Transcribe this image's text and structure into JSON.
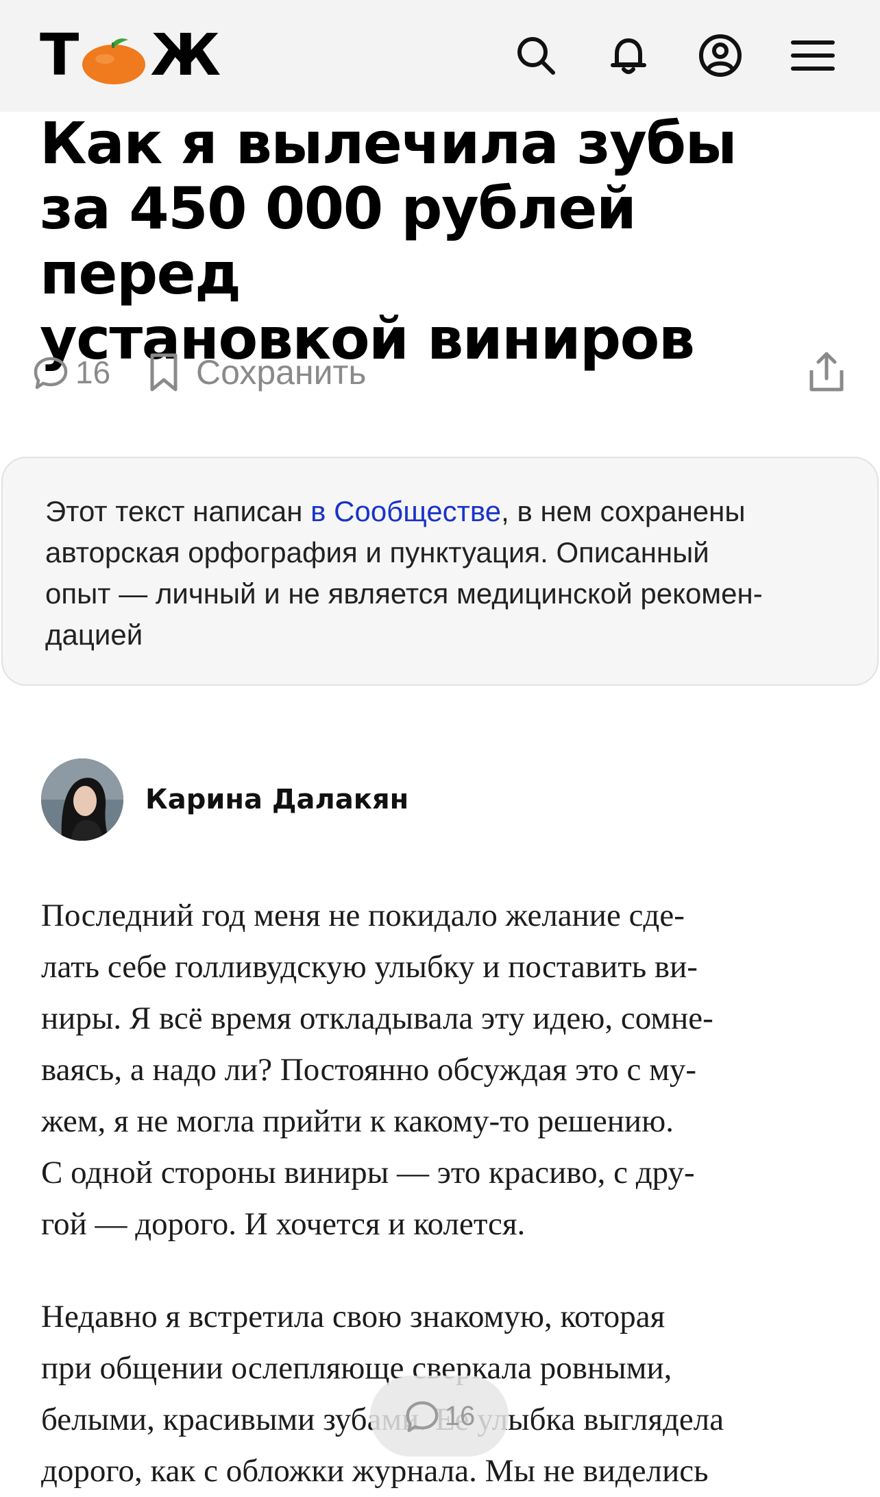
{
  "header": {
    "logo_left": "Т",
    "logo_right": "Ж",
    "icons": [
      "search-icon",
      "bell-icon",
      "profile-icon",
      "menu-icon"
    ]
  },
  "article": {
    "title_lines": [
      "Как я вылечила зубы",
      "за 450 000 рублей перед",
      "установкой виниров"
    ],
    "comments_count": "16",
    "save_label": "Сохранить"
  },
  "notice": {
    "before_link": "Этот текст написан ",
    "link": "в Сообществе",
    "after_link_line1": ", в нем сохранены",
    "line2": "авторская орфография и пунктуация. Описанный",
    "line3": "опыт — личный и не является медицинской рекомен-",
    "line4": "дацией"
  },
  "author": {
    "name": "Карина Далакян"
  },
  "paragraphs": {
    "p1": [
      "Последний год меня не покидало желание сде-",
      "лать себе голливудскую улыбку и поставить ви-",
      "ниры. Я всё время откладывала эту идею, сомне-",
      "ваясь, а надо ли? Постоянно обсуждая это с му-",
      "жем, я не могла прийти к какому-то решению.",
      "С одной стороны виниры — это красиво, с дру-",
      "гой — дорого. И хочется и колется."
    ],
    "p2": [
      "Недавно я встретила свою знакомую, которая",
      "при общении ослепляюще сверкала ровными,",
      "белыми, красивыми зубами. Ее улыбка выглядела",
      "дорого, как с обложки журнала. Мы не виделись"
    ]
  },
  "floating": {
    "comments_count": "16"
  },
  "colors": {
    "header_bg": "#f3f3f3",
    "logo_orange": "#f07a1e",
    "link_blue": "#1a33c8",
    "muted": "#8a8a8a"
  }
}
